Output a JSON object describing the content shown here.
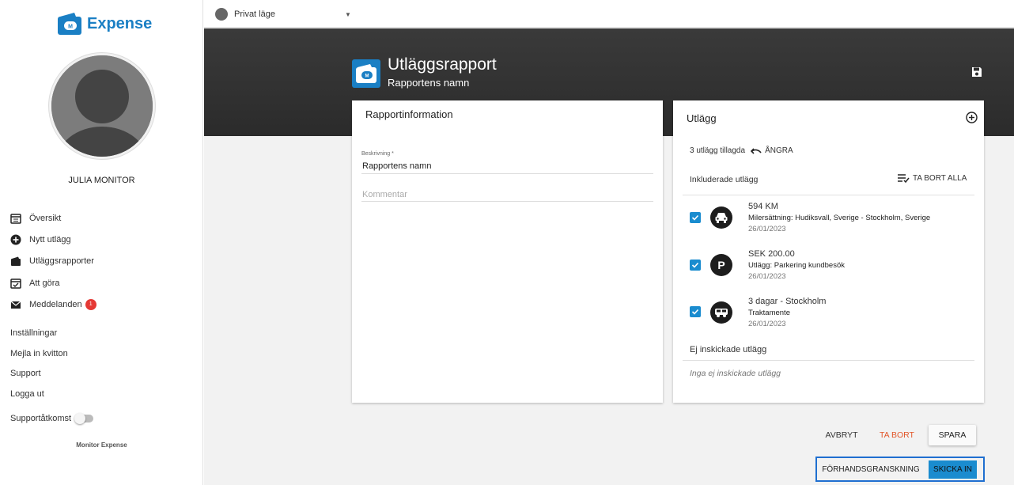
{
  "app": {
    "name": "Expense",
    "brand_color": "#1a7fc4"
  },
  "user": {
    "name": "JULIA MONITOR"
  },
  "sidebar": {
    "nav": [
      {
        "label": "Översikt",
        "icon": "calendar-list-icon"
      },
      {
        "label": "Nytt utlägg",
        "icon": "plus-circle-icon"
      },
      {
        "label": "Utläggsrapporter",
        "icon": "wallet-icon"
      },
      {
        "label": "Att göra",
        "icon": "calendar-check-icon"
      },
      {
        "label": "Meddelanden",
        "icon": "mail-icon",
        "badge": "1"
      }
    ],
    "links": [
      "Inställningar",
      "Mejla in kvitton",
      "Support",
      "Logga ut"
    ],
    "support_access": "Supportåtkomst",
    "footer": "Monitor Expense"
  },
  "topbar": {
    "mode": "Privat läge"
  },
  "header": {
    "title": "Utläggsrapport",
    "subtitle": "Rapportens namn"
  },
  "report_info": {
    "title": "Rapportinformation",
    "description_label": "Beskrivning *",
    "description_value": "Rapportens namn",
    "comment_placeholder": "Kommentar"
  },
  "expenses": {
    "title": "Utlägg",
    "added_text": "3 utlägg tillagda",
    "undo_label": "ÅNGRA",
    "included_header": "Inkluderade utlägg",
    "remove_all_label": "TA BORT ALLA",
    "items": [
      {
        "amount": "594 KM",
        "description": "Milersättning: Hudiksvall, Sverige - Stockholm, Sverige",
        "date": "26/01/2023",
        "icon": "car-icon",
        "checked": true
      },
      {
        "amount": "SEK 200.00",
        "description": "Utlägg: Parkering kundbesök",
        "date": "26/01/2023",
        "icon": "parking-icon",
        "icon_text": "P",
        "checked": true
      },
      {
        "amount": "3 dagar - Stockholm",
        "description": "Traktamente",
        "date": "26/01/2023",
        "icon": "bus-icon",
        "checked": true
      }
    ],
    "unsent_header": "Ej inskickade utlägg",
    "unsent_empty": "Inga ej inskickade utlägg"
  },
  "actions": {
    "cancel": "AVBRYT",
    "delete": "TA BORT",
    "save": "SPARA",
    "preview": "FÖRHANDSGRANSKNING",
    "submit": "SKICKA IN"
  }
}
